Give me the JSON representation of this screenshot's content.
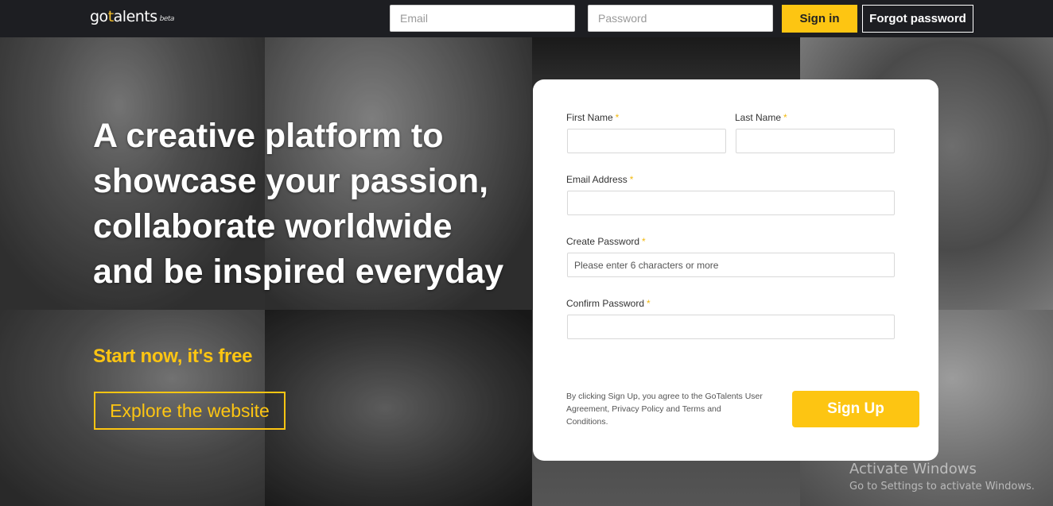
{
  "header": {
    "logo": {
      "go": "go",
      "t": "t",
      "rest": "alents",
      "beta": "beta"
    },
    "email_placeholder": "Email",
    "password_placeholder": "Password",
    "signin_label": "Sign in",
    "forgot_label": "Forgot password"
  },
  "hero": {
    "headline_lines": [
      "A creative platform to",
      "showcase your passion,",
      "collaborate worldwide",
      "and be inspired everyday"
    ],
    "tagline": "Start now, it's free",
    "explore_label": "Explore the website"
  },
  "signup": {
    "first_name_label": "First Name",
    "last_name_label": "Last Name",
    "email_label": "Email Address",
    "create_password_label": "Create Password",
    "create_password_placeholder": "Please enter 6 characters or more",
    "confirm_password_label": "Confirm Password",
    "required_mark": "*",
    "terms_text": "By clicking Sign Up, you agree to the GoTalents User Agreement, Privacy Policy and Terms and Conditions.",
    "signup_label": "Sign Up"
  },
  "watermark": {
    "title": "Activate Windows",
    "subtitle": "Go to Settings to activate Windows."
  },
  "colors": {
    "accent": "#fdc512",
    "topbar": "#1d1e22"
  }
}
